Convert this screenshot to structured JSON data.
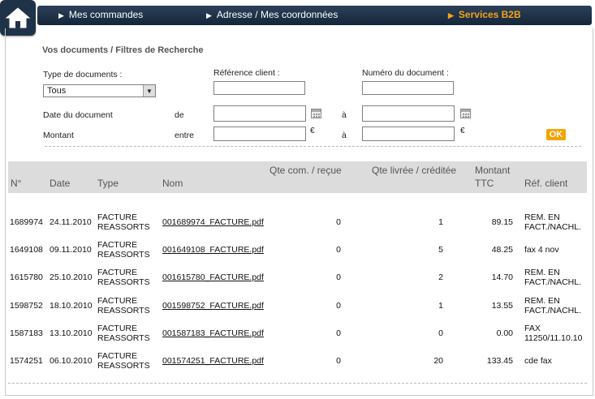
{
  "nav": {
    "items": [
      {
        "label": "Mes commandes"
      },
      {
        "label": "Adresse / Mes coordonnées"
      },
      {
        "label": "Services B2B"
      }
    ]
  },
  "filters": {
    "title": "Vos documents / Filtres de Recherche",
    "type_label": "Type de documents :",
    "type_value": "Tous",
    "ref_label": "Référence client :",
    "ref_value": "",
    "num_label": "Numéro du document :",
    "num_value": "",
    "date_label": "Date du document",
    "date_from_label": "de",
    "date_to_label": "à",
    "date_from": "",
    "date_to": "",
    "amount_label": "Montant",
    "amount_between_label": "entre",
    "amount_to_label": "à",
    "amount_from": "",
    "amount_to": "",
    "currency": "€",
    "ok_label": "OK"
  },
  "table": {
    "headers": {
      "num": "N°",
      "date": "Date",
      "type": "Type",
      "name": "Nom",
      "qty_ordered": "Qte com. / reçue",
      "qty_delivered": "Qte livrée / créditée",
      "amount_1": "Montant",
      "amount_2": "TTC",
      "ref": "Réf. client"
    },
    "rows": [
      {
        "num": "1689974",
        "date": "24.11.2010",
        "type1": "FACTURE",
        "type2": "REASSORTS",
        "name": "001689974_FACTURE.pdf",
        "qty_ordered": "0",
        "qty_delivered": "1",
        "amount": "89.15",
        "ref1": "REM. EN",
        "ref2": "FACT./NACHL."
      },
      {
        "num": "1649108",
        "date": "09.11.2010",
        "type1": "FACTURE",
        "type2": "REASSORTS",
        "name": "001649108_FACTURE.pdf",
        "qty_ordered": "0",
        "qty_delivered": "5",
        "amount": "48.25",
        "ref1": "fax 4 nov",
        "ref2": ""
      },
      {
        "num": "1615780",
        "date": "25.10.2010",
        "type1": "FACTURE",
        "type2": "REASSORTS",
        "name": "001615780_FACTURE.pdf",
        "qty_ordered": "0",
        "qty_delivered": "2",
        "amount": "14.70",
        "ref1": "REM. EN",
        "ref2": "FACT./NACHL."
      },
      {
        "num": "1598752",
        "date": "18.10.2010",
        "type1": "FACTURE",
        "type2": "REASSORTS",
        "name": "001598752_FACTURE.pdf",
        "qty_ordered": "0",
        "qty_delivered": "1",
        "amount": "13.55",
        "ref1": "REM. EN",
        "ref2": "FACT./NACHL."
      },
      {
        "num": "1587183",
        "date": "13.10.2010",
        "type1": "FACTURE",
        "type2": "REASSORTS",
        "name": "001587183_FACTURE.pdf",
        "qty_ordered": "0",
        "qty_delivered": "0",
        "amount": "0.00",
        "ref1": "FAX",
        "ref2": "11250/11.10.10"
      },
      {
        "num": "1574251",
        "date": "06.10.2010",
        "type1": "FACTURE",
        "type2": "REASSORTS",
        "name": "001574251_FACTURE.pdf",
        "qty_ordered": "0",
        "qty_delivered": "20",
        "amount": "133.45",
        "ref1": "cde fax",
        "ref2": ""
      }
    ]
  }
}
